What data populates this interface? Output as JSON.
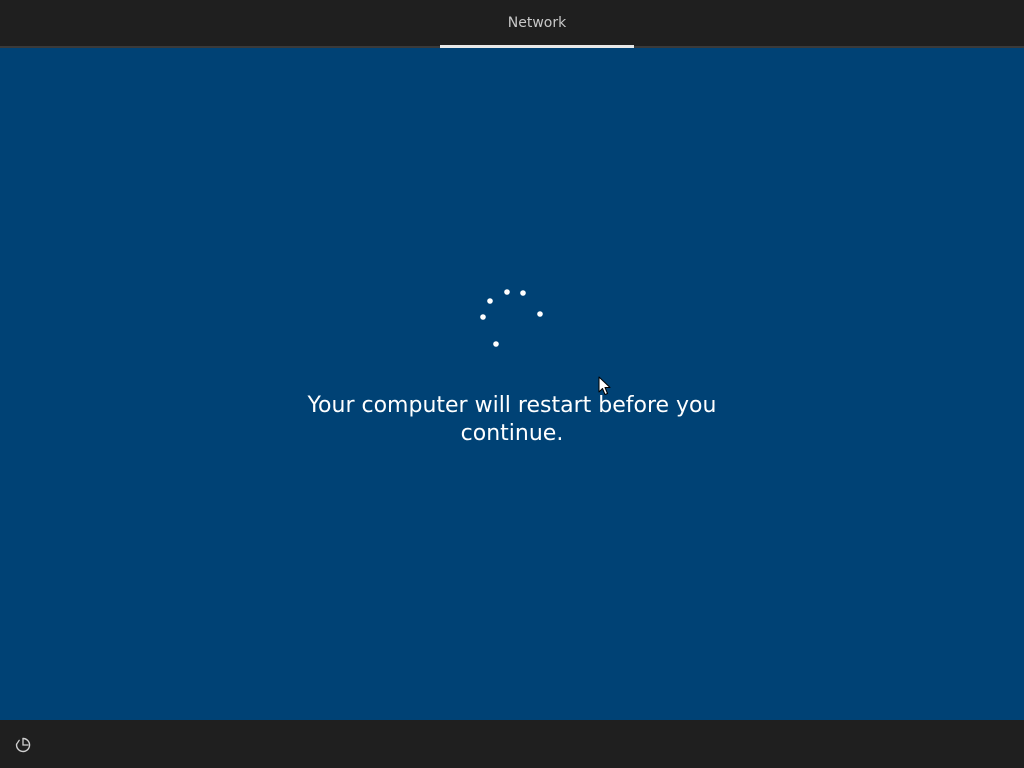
{
  "header": {
    "tab_label": "Network"
  },
  "main": {
    "message": "Your computer will restart before you continue."
  },
  "colors": {
    "background": "#004275",
    "bar": "#1f1f1f",
    "text": "#ffffff"
  },
  "icons": {
    "spinner": "loading-spinner",
    "cursor": "mouse-pointer",
    "accessibility": "ease-of-access-icon"
  }
}
